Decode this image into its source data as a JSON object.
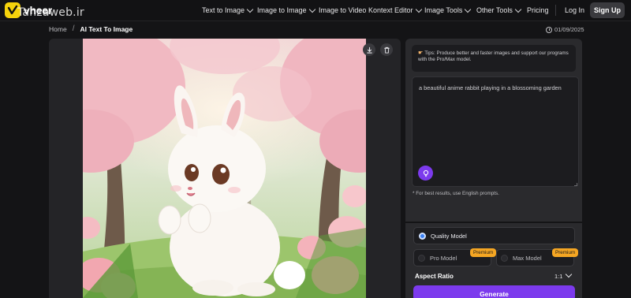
{
  "nav": {
    "brand": "vheer",
    "watermark": "Tanzaweb.ir",
    "items": [
      {
        "label": "Text to Image",
        "dropdown": true
      },
      {
        "label": "Image to Image",
        "dropdown": true
      },
      {
        "label": "Image to Video",
        "dropdown": false
      },
      {
        "label": "Kontext Editor",
        "dropdown": true
      },
      {
        "label": "Image Tools",
        "dropdown": true
      },
      {
        "label": "Other Tools",
        "dropdown": true
      },
      {
        "label": "Pricing",
        "dropdown": false
      }
    ],
    "login": "Log In",
    "signup": "Sign Up"
  },
  "breadcrumb": {
    "home": "Home",
    "separator": "/",
    "current": "AI Text To Image"
  },
  "date": "01/09/2025",
  "image": {
    "icons": [
      "download-icon",
      "trash-icon"
    ]
  },
  "tips": {
    "icon": "pointing-hand-icon",
    "text": "Tips: Produce better and faster images and support our programs with the Pro/Max model."
  },
  "prompt": {
    "value": "a beautiful anime rabbit playing in a blossoming garden",
    "hint": "* For best results, use English prompts."
  },
  "models": {
    "quality": "Quality Model",
    "pro": "Pro Model",
    "max": "Max Model",
    "premium_badge": "Premium"
  },
  "aspect": {
    "label": "Aspect Ratio",
    "value": "1:1"
  },
  "generate_label": "Generate",
  "colors": {
    "accent": "#7c3aed",
    "brand": "#f5d20b",
    "premium": "#f5a623",
    "radio": "#3b82f6"
  }
}
